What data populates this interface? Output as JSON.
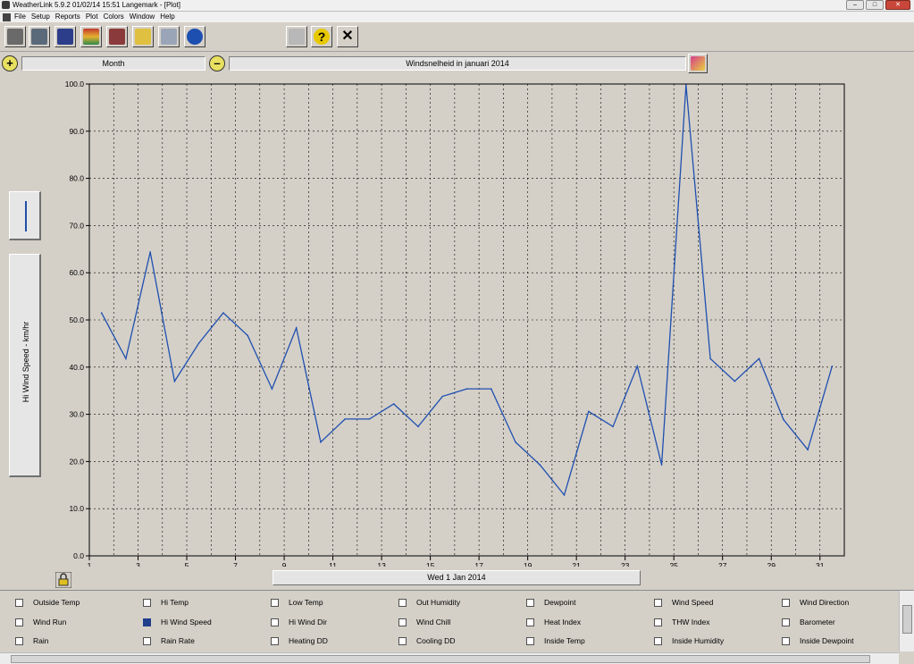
{
  "window": {
    "title": "WeatherLink 5.9.2  01/02/14  15:51  Langemark - [Plot]",
    "min": "–",
    "max": "□",
    "close": "✕"
  },
  "menu": [
    "File",
    "Setup",
    "Reports",
    "Plot",
    "Colors",
    "Window",
    "Help"
  ],
  "toolbar": {
    "icons": [
      "station-icon",
      "walrus-icon",
      "bulletin-icon",
      "plot-icon",
      "strip-chart-icon",
      "summary-icon",
      "noaa-report-icon",
      "noaa-logo-icon",
      "printer-icon",
      "help-icon",
      "close-icon"
    ],
    "help_glyph": "?",
    "close_glyph": "✕"
  },
  "range": {
    "zoom_in": "+",
    "zoom_out": "–",
    "period": "Month",
    "plot_title": "Windsnelheid in januari 2014"
  },
  "yaxis_label": "Hi Wind Speed - km/hr",
  "xaxis_title": "Wed 1 Jan 2014",
  "chart_data": {
    "type": "line",
    "x_ticks": [
      "1",
      "3",
      "5",
      "7",
      "9",
      "11",
      "13",
      "15",
      "17",
      "19",
      "21",
      "23",
      "25",
      "27",
      "29",
      "31"
    ],
    "y_ticks": [
      "0.0",
      "10.0",
      "20.0",
      "30.0",
      "40.0",
      "50.0",
      "60.0",
      "70.0",
      "80.0",
      "90.0",
      "100.0"
    ],
    "ylim": [
      0,
      100
    ],
    "xlim": [
      1,
      32
    ],
    "grid": true,
    "series": [
      {
        "color": "#1f4fb0",
        "x": [
          1.5,
          2.5,
          3.5,
          4.5,
          5.5,
          6.5,
          7.5,
          8.5,
          9.5,
          10.5,
          11.5,
          12.5,
          13.5,
          14.5,
          15.5,
          16.5,
          17.5,
          18.5,
          19.5,
          20.5,
          21.5,
          22.5,
          23.5,
          24.5,
          25.5,
          26.5,
          27.5,
          28.5,
          29.5,
          30.5,
          31.5
        ],
        "values": [
          51.5,
          41.8,
          64.4,
          37.0,
          45.1,
          51.5,
          46.7,
          35.4,
          48.3,
          24.1,
          29.0,
          29.0,
          32.2,
          27.4,
          33.8,
          35.4,
          35.4,
          24.1,
          19.3,
          12.9,
          30.6,
          27.4,
          40.2,
          19.3,
          99.8,
          41.8,
          37.0,
          41.8,
          28.9,
          22.5,
          40.2
        ]
      }
    ]
  },
  "checkboxes": [
    [
      "Outside Temp",
      "Hi Temp",
      "Low Temp",
      "Out Humidity",
      "Dewpoint",
      "Wind Speed",
      "Wind Direction"
    ],
    [
      "Wind Run",
      "Hi Wind Speed",
      "Hi Wind Dir",
      "Wind Chill",
      "Heat Index",
      "THW Index",
      "Barometer"
    ],
    [
      "Rain",
      "Rain Rate",
      "Heating DD",
      "Cooling DD",
      "Inside Temp",
      "Inside Humidity",
      "Inside Dewpoint"
    ]
  ],
  "checked": [
    "Hi Wind Speed"
  ]
}
